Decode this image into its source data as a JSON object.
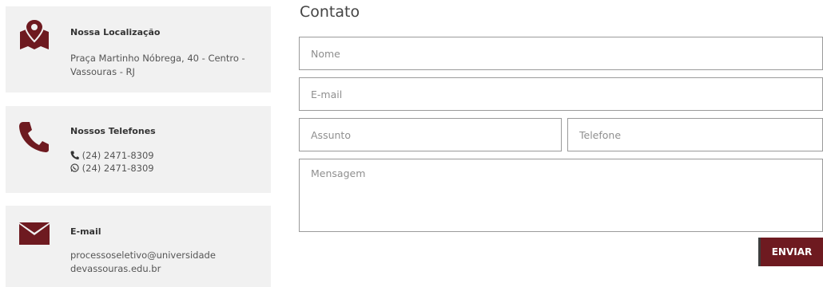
{
  "colors": {
    "accent": "#6e1a20",
    "card_bg": "#f1f1f1"
  },
  "info_cards": {
    "location": {
      "icon": "map-pin-icon",
      "title": "Nossa Localização",
      "line1": "Praça Martinho Nóbrega, 40 - Centro -",
      "line2": "Vassouras - RJ"
    },
    "phones": {
      "icon": "phone-icon",
      "title": "Nossos Telefones",
      "phone": "(24) 2471-8309",
      "whatsapp": "(24) 2471-8309"
    },
    "email": {
      "icon": "envelope-icon",
      "title": "E-mail",
      "line1": "processoseletivo@universidade",
      "line2": "devassouras.edu.br"
    }
  },
  "form": {
    "heading": "Contato",
    "name_placeholder": "Nome",
    "email_placeholder": "E-mail",
    "subject_placeholder": "Assunto",
    "phone_placeholder": "Telefone",
    "message_placeholder": "Mensagem",
    "submit_label": "ENVIAR"
  }
}
